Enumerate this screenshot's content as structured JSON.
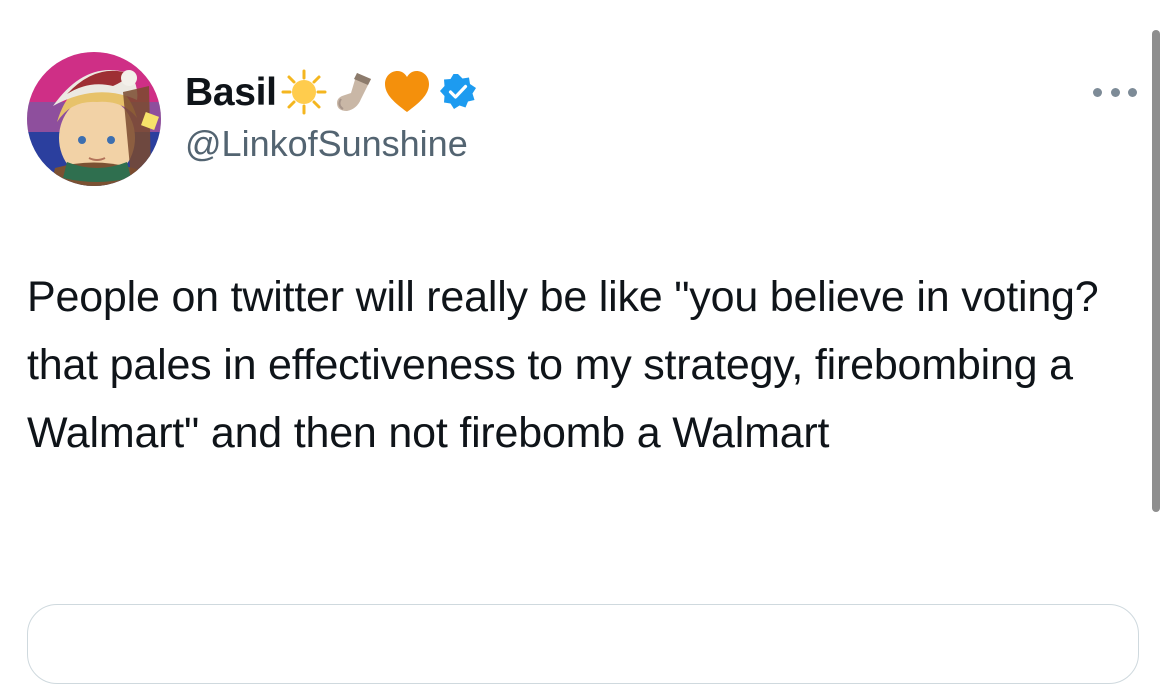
{
  "tweet": {
    "author": {
      "display_name": "Basil",
      "handle": "@LinkofSunshine",
      "name_emojis": [
        "sun-icon",
        "sock-icon",
        "orange-heart-icon"
      ],
      "verified": true,
      "avatar": "avatar-image"
    },
    "text": "People on twitter will really be like \"you believe in voting? that pales in effectiveness to my strategy, firebombing a Walmart\" and then not firebomb a Walmart",
    "more_menu_icon": "more-options-icon"
  },
  "colors": {
    "text_primary": "#0f1419",
    "text_secondary": "#536471",
    "verified_blue": "#1d9bf0",
    "heart_orange": "#f4900c",
    "border": "#cfd9de"
  }
}
